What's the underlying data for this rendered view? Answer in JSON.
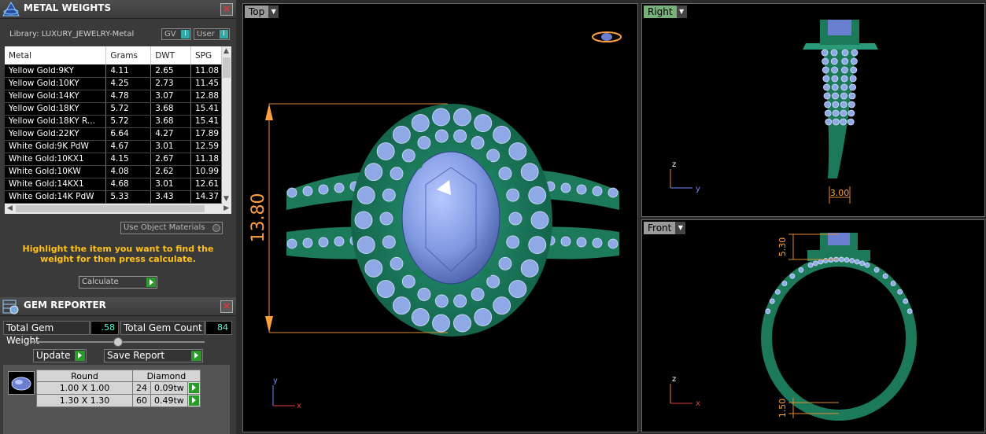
{
  "metal_weights": {
    "title": "METAL WEIGHTS",
    "close": "×",
    "library_label": "Library: LUXURY_JEWELRY-Metal",
    "toggle_gv": "GV",
    "toggle_user": "User",
    "columns": [
      "Metal",
      "Grams",
      "DWT",
      "SPG"
    ],
    "rows": [
      [
        "Yellow Gold:9KY",
        "4.11",
        "2.65",
        "11.08"
      ],
      [
        "Yellow Gold:10KY",
        "4.25",
        "2.73",
        "11.45"
      ],
      [
        "Yellow Gold:14KY",
        "4.78",
        "3.07",
        "12.88"
      ],
      [
        "Yellow Gold:18KY",
        "5.72",
        "3.68",
        "15.41"
      ],
      [
        "Yellow Gold:18KY R...",
        "5.72",
        "3.68",
        "15.41"
      ],
      [
        "Yellow Gold:22KY",
        "6.64",
        "4.27",
        "17.89"
      ],
      [
        "White Gold:9K PdW",
        "4.67",
        "3.01",
        "12.59"
      ],
      [
        "White Gold:10KX1",
        "4.15",
        "2.67",
        "11.18"
      ],
      [
        "White Gold:10KW",
        "4.08",
        "2.62",
        "10.99"
      ],
      [
        "White Gold:14KX1",
        "4.68",
        "3.01",
        "12.61"
      ],
      [
        "White Gold:14K PdW",
        "5.33",
        "3.43",
        "14.37"
      ]
    ],
    "use_object_materials": "Use Object Materials",
    "hint": "Highlight the item you want to find the weight for then press calculate.",
    "calculate": "Calculate"
  },
  "gem_reporter": {
    "title": "GEM REPORTER",
    "close": "×",
    "total_weight_label": "Total Gem Weight",
    "total_weight_value": ".58",
    "total_count_label": "Total Gem Count",
    "total_count_value": "84",
    "update": "Update",
    "save_report": "Save Report",
    "shape": "Round",
    "material": "Diamond",
    "rows": [
      [
        "1.00 X 1.00",
        "24",
        "0.09tw"
      ],
      [
        "1.30 X 1.30",
        "60",
        "0.49tw"
      ]
    ]
  },
  "viewports": {
    "top": {
      "label": "Top",
      "dimension": "13.80",
      "axis_y": "y",
      "axis_x": "x"
    },
    "right": {
      "label": "Right",
      "dimension": "3.00",
      "axis_z": "z",
      "axis_y": "y"
    },
    "front": {
      "label": "Front",
      "dimension_top": "5.30",
      "dimension_bottom": "1.50",
      "axis_z": "z",
      "axis_x": "x"
    }
  },
  "colors": {
    "metal": "#1f8060",
    "gem": "#8fa8e6",
    "dimension": "#ffa040"
  }
}
